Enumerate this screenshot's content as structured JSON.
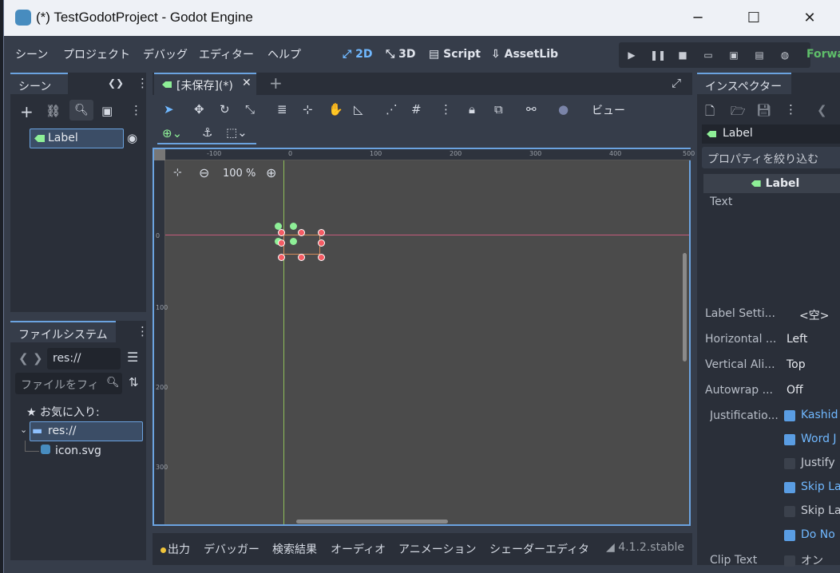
{
  "titlebar": {
    "title": "(*) TestGodotProject - Godot Engine"
  },
  "menu": {
    "items": [
      "シーン",
      "プロジェクト",
      "デバッグ",
      "エディター",
      "ヘルプ"
    ]
  },
  "workspaces": {
    "w2d": "2D",
    "w3d": "3D",
    "script": "Script",
    "assetlib": "AssetLib"
  },
  "renderer": "Forwa",
  "scene_dock": {
    "tab": "シーン",
    "node_label": "Label"
  },
  "filesystem": {
    "tab": "ファイルシステム",
    "path": "res://",
    "filter_placeholder": "ファイルをフィ",
    "favorites": "お気に入り:",
    "root": "res://",
    "file": "icon.svg"
  },
  "editor": {
    "tab_label": "[未保存](*)",
    "view_button": "ビュー",
    "zoom": "100 %",
    "ruler_h": [
      "-100",
      "0",
      "100",
      "200",
      "300",
      "400",
      "500"
    ],
    "ruler_v": [
      "0",
      "100",
      "200",
      "300"
    ]
  },
  "inspector": {
    "tab": "インスペクター",
    "node": "Label",
    "filter_placeholder": "プロパティを絞り込む",
    "section": "Label",
    "text_label": "Text",
    "props": [
      {
        "k": "Label Setti...",
        "v": "<空>"
      },
      {
        "k": "Horizontal ...",
        "v": "Left"
      },
      {
        "k": "Vertical Ali...",
        "v": "Top"
      },
      {
        "k": "Autowrap ...",
        "v": "Off"
      }
    ],
    "justification_label": "Justificatio...",
    "flags": [
      {
        "label": "Kashid",
        "on": true
      },
      {
        "label": "Word J",
        "on": true
      },
      {
        "label": "Justify",
        "on": false
      },
      {
        "label": "Skip La",
        "on": true
      },
      {
        "label": "Skip La",
        "on": false
      },
      {
        "label": "Do No",
        "on": true
      }
    ],
    "clip_label": "Clip Text",
    "clip_value": "オン"
  },
  "bottom": {
    "items": [
      "出力",
      "デバッガー",
      "検索結果",
      "オーディオ",
      "アニメーション",
      "シェーダーエディタ"
    ],
    "version": "4.1.2.stable"
  },
  "colors": {
    "accent": "#6ba3e0",
    "bg": "#363d4a",
    "panel": "#2a2f39",
    "canvas": "#4a4a4a"
  }
}
